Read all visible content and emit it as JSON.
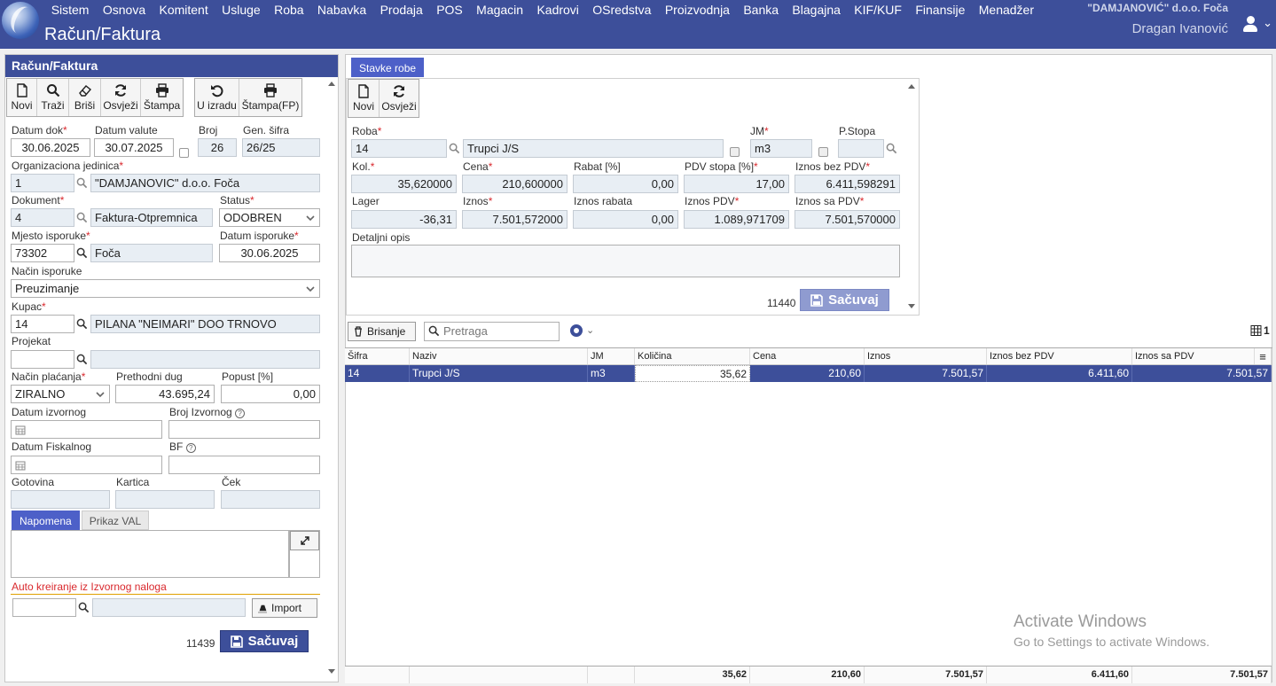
{
  "header": {
    "menu": [
      "Sistem",
      "Osnova",
      "Komitent",
      "Usluge",
      "Roba",
      "Nabavka",
      "Prodaja",
      "POS",
      "Magacin",
      "Kadrovi",
      "OSredstva",
      "Proizvodnja",
      "Banka",
      "Blagajna",
      "KIF/KUF",
      "Finansije",
      "Menadžer"
    ],
    "title": "Račun/Faktura",
    "company": "\"DAMJANOVIĆ\" d.o.o. Foča",
    "user": "Dragan Ivanović"
  },
  "left": {
    "panel_title": "Račun/Faktura",
    "toolbar": [
      "Novi",
      "Traži",
      "Briši",
      "Osvježi",
      "Štampa"
    ],
    "toolbar2": [
      "U izradu",
      "Štampa(FP)"
    ],
    "labels": {
      "datum_dok": "Datum dok",
      "datum_valute": "Datum valute",
      "broj": "Broj",
      "gen_sifra": "Gen. šifra",
      "org_jed": "Organizaciona jedinica",
      "dokument": "Dokument",
      "status": "Status",
      "mjesto_isporuke": "Mjesto isporuke",
      "datum_isporuke": "Datum isporuke",
      "nacin_isporuke": "Način isporuke",
      "kupac": "Kupac",
      "projekat": "Projekat",
      "nacin_placanja": "Način plaćanja",
      "prethodni_dug": "Prethodni dug",
      "popust": "Popust [%]",
      "datum_izvornog": "Datum izvornog",
      "broj_izvornog": "Broj Izvornog",
      "datum_fiskalnog": "Datum Fiskalnog",
      "bf": "BF",
      "gotovina": "Gotovina",
      "kartica": "Kartica",
      "cek": "Ček"
    },
    "values": {
      "datum_dok": "30.06.2025",
      "datum_valute": "30.07.2025",
      "broj": "26",
      "gen_sifra": "26/25",
      "org_jed_code": "1",
      "org_jed_name": "\"DAMJANOVIC\" d.o.o. Foča",
      "dokument_code": "4",
      "dokument_name": "Faktura-Otpremnica",
      "status": "ODOBREN",
      "mjesto_code": "73302",
      "mjesto_name": "Foča",
      "datum_isporuke": "30.06.2025",
      "nacin_isporuke": "Preuzimanje",
      "kupac_code": "14",
      "kupac_name": "PILANA \"NEIMARI\" DOO TRNOVO",
      "nacin_placanja": "ZIRALNO",
      "prethodni_dug": "43.695,24",
      "popust": "0,00"
    },
    "tabs": [
      "Napomena",
      "Prikaz VAL"
    ],
    "auto_text": "Auto kreiranje iz Izvornog naloga",
    "import_label": "Import",
    "doc_number": "11439",
    "save_label": "Sačuvaj"
  },
  "right": {
    "tab": "Stavke robe",
    "toolbar": [
      "Novi",
      "Osvježi"
    ],
    "labels": {
      "roba": "Roba",
      "jm": "JM",
      "pstopa": "P.Stopa",
      "kol": "Kol.",
      "cena": "Cena",
      "rabat": "Rabat [%]",
      "pdv_stopa": "PDV stopa [%]",
      "iznos_bez_pdv": "Iznos bez PDV",
      "lager": "Lager",
      "iznos": "Iznos",
      "iznos_rabata": "Iznos rabata",
      "iznos_pdv": "Iznos PDV",
      "iznos_sa_pdv": "Iznos sa PDV",
      "detaljni_opis": "Detaljni opis"
    },
    "values": {
      "roba_code": "14",
      "roba_name": "Trupci J/S",
      "jm": "m3",
      "kol": "35,620000",
      "cena": "210,600000",
      "rabat": "0,00",
      "pdv_stopa": "17,00",
      "iznos_bez_pdv": "6.411,598291",
      "lager": "-36,31",
      "iznos": "7.501,572000",
      "iznos_rabata": "0,00",
      "iznos_pdv": "1.089,971709",
      "iznos_sa_pdv": "7.501,570000"
    },
    "doc_number": "11440",
    "save_label": "Sačuvaj"
  },
  "grid": {
    "delete_label": "Brisanje",
    "search_placeholder": "Pretraga",
    "count": "1",
    "columns": [
      "Šifra",
      "Naziv",
      "JM",
      "Količina",
      "Cena",
      "Iznos",
      "Iznos bez PDV",
      "Iznos sa PDV"
    ],
    "rows": [
      [
        "14",
        "Trupci J/S",
        "m3",
        "35,62",
        "210,60",
        "7.501,57",
        "6.411,60",
        "7.501,57"
      ]
    ],
    "footer": [
      "",
      "",
      "",
      "35,62",
      "210,60",
      "7.501,57",
      "6.411,60",
      "7.501,57"
    ]
  },
  "watermark": {
    "title": "Activate Windows",
    "sub": "Go to Settings to activate Windows."
  },
  "colors": {
    "brand": "#3d4f9a",
    "tab_active": "#4d60c8",
    "required": "#d9282d"
  }
}
